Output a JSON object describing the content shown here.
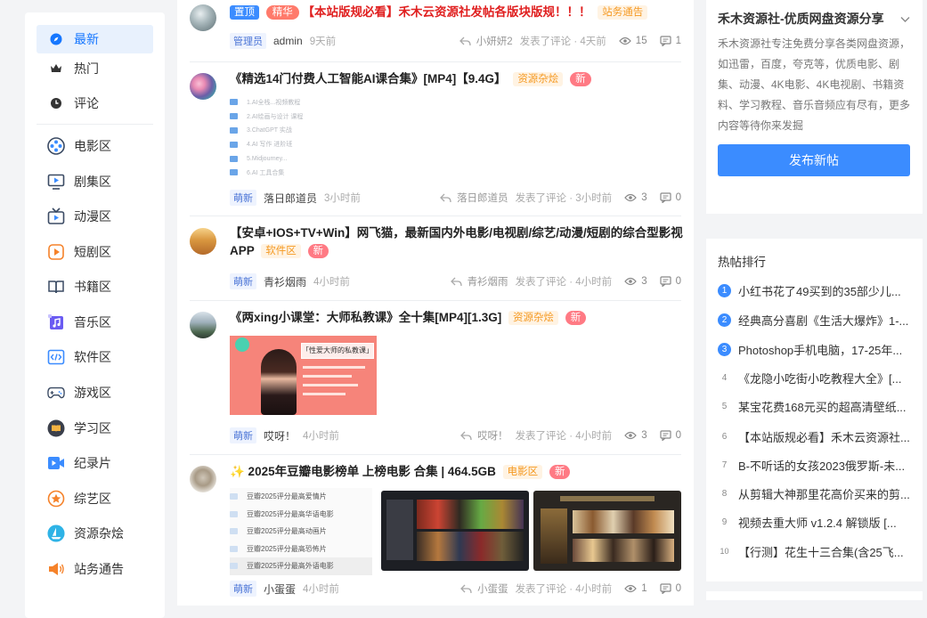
{
  "nav": {
    "items": [
      {
        "label": "最新",
        "icon": "compass-icon",
        "active": true
      },
      {
        "label": "热门",
        "icon": "crown-icon"
      },
      {
        "label": "评论",
        "icon": "clock-icon"
      },
      {
        "label": "电影区",
        "icon": "film-reel-icon"
      },
      {
        "label": "剧集区",
        "icon": "tv-play-icon"
      },
      {
        "label": "动漫区",
        "icon": "anime-tv-icon"
      },
      {
        "label": "短剧区",
        "icon": "short-play-icon"
      },
      {
        "label": "书籍区",
        "icon": "book-icon"
      },
      {
        "label": "音乐区",
        "icon": "music-icon"
      },
      {
        "label": "软件区",
        "icon": "code-icon"
      },
      {
        "label": "游戏区",
        "icon": "gamepad-icon"
      },
      {
        "label": "学习区",
        "icon": "study-icon"
      },
      {
        "label": "纪录片",
        "icon": "video-camera-icon"
      },
      {
        "label": "综艺区",
        "icon": "star-badge-icon"
      },
      {
        "label": "资源杂烩",
        "icon": "boat-icon"
      },
      {
        "label": "站务通告",
        "icon": "megaphone-icon"
      }
    ]
  },
  "posts": [
    {
      "tag_top": "置顶",
      "tag_hot": "精华",
      "title": "【本站版规必看】禾木云资源社发帖各版块版规！！！",
      "tag": "站务通告",
      "role": "管理员",
      "user": "admin",
      "time": "9天前",
      "reply_user": "小妍妍2",
      "reply_text": "发表了评论 · 4天前",
      "views": "15",
      "comments": "1"
    },
    {
      "title": "《精选14门付费人工智能AI课合集》[MP4]【9.4G】",
      "tag": "资源杂烩",
      "new": "新",
      "role": "萌新",
      "user": "落日郎道员",
      "time": "3小时前",
      "reply_user": "落日郎道员",
      "reply_text": "发表了评论 · 3小时前",
      "views": "3",
      "comments": "0",
      "files": [
        "1.AI全栈...视频教程",
        "2.AI绘画与设计 课程",
        "3.ChatGPT 实战",
        "4.AI 写作 进阶班",
        "5.Midjourney...",
        "6.AI 工具合集"
      ]
    },
    {
      "title": "【安卓+IOS+TV+Win】网飞猫，最新国内外电影/电视剧/综艺/动漫/短剧的综合型影视APP",
      "tag": "软件区",
      "new": "新",
      "role": "萌新",
      "user": "青衫烟雨",
      "time": "4小时前",
      "reply_user": "青衫烟雨",
      "reply_text": "发表了评论 · 4小时前",
      "views": "3",
      "comments": "0"
    },
    {
      "title": "《两xing小课堂：大师私教课》全十集[MP4][1.3G]",
      "tag": "资源杂烩",
      "new": "新",
      "role": "萌新",
      "user": "哎呀！",
      "time": "4小时前",
      "reply_user": "哎呀！",
      "reply_text": "发表了评论 · 4小时前",
      "views": "3",
      "comments": "0",
      "img_text": "「性爱大师的私教课」"
    },
    {
      "title": "✨ 2025年豆瓣电影榜单 上榜电影 合集 | 464.5GB",
      "tag": "电影区",
      "new": "新",
      "role": "萌新",
      "user": "小蛋蛋",
      "time": "4小时前",
      "reply_user": "小蛋蛋",
      "reply_text": "发表了评论 · 4小时前",
      "views": "1",
      "comments": "0",
      "files": [
        "豆瓣2025评分最高爱情片",
        "豆瓣2025评分最高华语电影",
        "豆瓣2025评分最高动画片",
        "豆瓣2025评分最高恐怖片",
        "豆瓣2025评分最高外语电影"
      ]
    }
  ],
  "sidebar": {
    "site_name": "禾木资源社-优质网盘资源分享",
    "site_desc": "禾木资源社专注免费分享各类网盘资源，如迅雷，百度，夸克等，优质电影、剧集、动漫、4K电影、4K电视剧、书籍资料、学习教程、音乐音频应有尽有，更多内容等待你来发掘",
    "post_button": "发布新帖",
    "hot_title": "热帖排行",
    "hot_items": [
      {
        "rank": "1",
        "text": "小红书花了49买到的35部少儿..."
      },
      {
        "rank": "2",
        "text": "经典高分喜剧《生活大爆炸》1-..."
      },
      {
        "rank": "3",
        "text": "Photoshop手机电脑，17-25年..."
      },
      {
        "rank": "4",
        "text": "《龙隐小吃街小吃教程大全》[..."
      },
      {
        "rank": "5",
        "text": "某宝花费168元买的超高清壁纸..."
      },
      {
        "rank": "6",
        "text": "【本站版规必看】禾木云资源社..."
      },
      {
        "rank": "7",
        "text": "B-不听话的女孩2023俄罗斯-未..."
      },
      {
        "rank": "8",
        "text": "从剪辑大神那里花高价买来的剪..."
      },
      {
        "rank": "9",
        "text": "视频去重大师 v1.2.4 解锁版 [..."
      },
      {
        "rank": "10",
        "text": "【行测】花生十三合集(含25飞..."
      }
    ]
  },
  "colors": {
    "accent": "#3b8cff",
    "danger": "#e02020",
    "tag_orange": "#f59a23"
  }
}
